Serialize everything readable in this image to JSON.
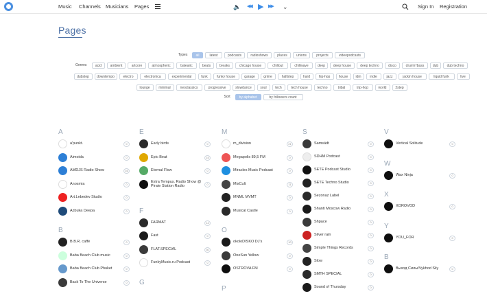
{
  "nav": {
    "music": "Music",
    "channels": "Channels",
    "musicians": "Musicians",
    "pages": "Pages"
  },
  "player": {
    "volume": "🔈",
    "prev": "◀◀",
    "play": "▶",
    "next": "▶▶",
    "expand": "⌄"
  },
  "account": {
    "signin": "Sign In",
    "register": "Registration"
  },
  "page": {
    "title": "Pages"
  },
  "filters": {
    "types_label": "Types",
    "types": [
      "all",
      "latest",
      "podcasts",
      "radioshows",
      "places",
      "unions",
      "projects",
      "videopodcasts"
    ],
    "genres_label": "Genres",
    "genres_rows": [
      [
        "acid",
        "ambient",
        "artcore",
        "atmospheric",
        "balearic",
        "beats",
        "breaks",
        "chicago house",
        "chillout",
        "chillwave",
        "deep",
        "deep house",
        "deep techno",
        "disco",
        "drum'n'bass",
        "dub",
        "dub techno"
      ],
      [
        "dubstep",
        "downtempo",
        "electro",
        "electronica",
        "experimental",
        "funk",
        "funky house",
        "garage",
        "grime",
        "halfstep",
        "hard",
        "hip-hop",
        "house",
        "idm",
        "indie",
        "jazz",
        "jackin house",
        "liquid funk",
        "live"
      ],
      [
        "lounge",
        "minimal",
        "neoclassics",
        "progressive",
        "slowdance",
        "soul",
        "tech",
        "tech house",
        "techno",
        "tribal",
        "trip-hop",
        "world",
        "2step"
      ]
    ],
    "sort_label": "Sort",
    "sort": [
      "by alphabet",
      "by followers count"
    ]
  },
  "columns": [
    {
      "groups": [
        {
          "letter": "A",
          "items": [
            {
              "name": "a'punkt.",
              "count": "0"
            },
            {
              "name": "Aimoida",
              "count": "0"
            },
            {
              "name": "AMDJS Radio Show",
              "count": "16"
            },
            {
              "name": "Anosmia",
              "count": "0"
            },
            {
              "name": "Art.Lebedev Studio",
              "count": "0"
            },
            {
              "name": "Azbuka Deepa",
              "count": "0"
            }
          ]
        },
        {
          "letter": "B",
          "items": [
            {
              "name": "B.B.R. caffé",
              "count": "0"
            },
            {
              "name": "Baba Beach Club music",
              "count": "0"
            },
            {
              "name": "Baba Beach Club Phuket",
              "count": "0"
            },
            {
              "name": "Back To The Universe",
              "count": "0"
            }
          ]
        }
      ]
    },
    {
      "groups": [
        {
          "letter": "E",
          "items": [
            {
              "name": "Early birds",
              "count": "0"
            },
            {
              "name": "Epic Beat",
              "count": "15"
            },
            {
              "name": "Eternal Flow",
              "count": "0"
            },
            {
              "name": "Extra Tempus. Radio Show @ Pirate Station Radio",
              "count": "0"
            }
          ]
        },
        {
          "letter": "F",
          "items": [
            {
              "name": "FARMAT",
              "count": "14"
            },
            {
              "name": "Fast",
              "count": "0"
            },
            {
              "name": "FLAT.SPECIAL",
              "count": "30"
            },
            {
              "name": "FunkyMusic.ru Podcast",
              "count": "0"
            }
          ]
        },
        {
          "letter": "G",
          "items": []
        }
      ]
    },
    {
      "groups": [
        {
          "letter": "M",
          "items": [
            {
              "name": "m_division",
              "count": "21"
            },
            {
              "name": "Megapolis 89,5 FM",
              "count": "0"
            },
            {
              "name": "Miracles Music Podcast",
              "count": "0"
            },
            {
              "name": "MixCult",
              "count": "11"
            },
            {
              "name": "MNML MVMT",
              "count": "0"
            },
            {
              "name": "Musical Castle",
              "count": "0"
            }
          ]
        },
        {
          "letter": "O",
          "items": [
            {
              "name": "okoloDISKO DJ's",
              "count": "10"
            },
            {
              "name": "OneSun Yellow",
              "count": "0"
            },
            {
              "name": "OSTROVA FM",
              "count": "0"
            }
          ]
        },
        {
          "letter": "P",
          "items": []
        }
      ]
    },
    {
      "groups": [
        {
          "letter": "S",
          "items": [
            {
              "name": "Samsädt",
              "count": "0"
            },
            {
              "name": "SDHM Podcast",
              "count": "0"
            },
            {
              "name": "SETE Podcast Studio",
              "count": "0"
            },
            {
              "name": "SETE Techno Studio",
              "count": "0"
            },
            {
              "name": "Sezonaz Label",
              "count": "0"
            },
            {
              "name": "Shanti Moscow Radio",
              "count": "0"
            },
            {
              "name": "Shpace",
              "count": "0"
            },
            {
              "name": "Silver rain",
              "count": "0"
            },
            {
              "name": "Simple Things Records",
              "count": "0"
            },
            {
              "name": "Slow",
              "count": "0"
            },
            {
              "name": "SMTH SPECIAL",
              "count": "0"
            },
            {
              "name": "Sound of Thursday",
              "count": "0"
            }
          ]
        }
      ]
    },
    {
      "groups": [
        {
          "letter": "V",
          "items": [
            {
              "name": "Vertical Solitude",
              "count": "0"
            }
          ]
        },
        {
          "letter": "W",
          "items": [
            {
              "name": "Wax Ninja",
              "count": "0"
            }
          ]
        },
        {
          "letter": "X",
          "items": [
            {
              "name": "XOROVOD",
              "count": "0"
            }
          ]
        },
        {
          "letter": "Y",
          "items": [
            {
              "name": "YOU_FOR",
              "count": "0"
            }
          ]
        },
        {
          "letter": "В",
          "items": [
            {
              "name": "Выход Силы/Vykhod Sily",
              "count": "0"
            }
          ]
        }
      ]
    }
  ]
}
